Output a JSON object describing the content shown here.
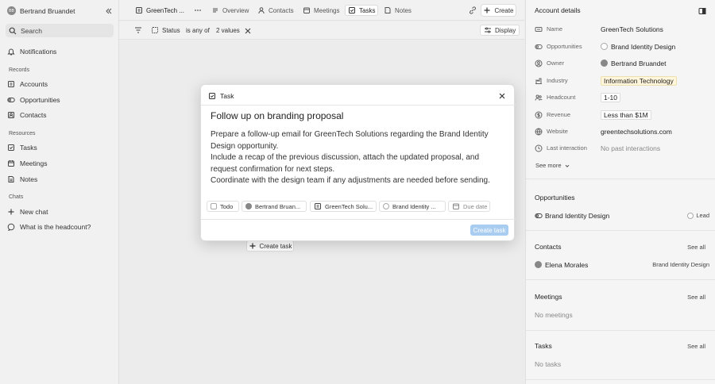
{
  "sidebar": {
    "workspace": {
      "initials": "BB",
      "name": "Bertrand Bruandet"
    },
    "search_label": "Search",
    "notifications": "Notifications",
    "records_heading": "Records",
    "records": [
      "Accounts",
      "Opportunities",
      "Contacts"
    ],
    "resources_heading": "Resources",
    "resources": [
      "Tasks",
      "Meetings",
      "Notes"
    ],
    "chats_heading": "Chats",
    "chats": [
      "New chat",
      "What is the headcount?"
    ]
  },
  "topbar": {
    "crumb": "GreenTech ...",
    "tabs": [
      "Overview",
      "Contacts",
      "Meetings",
      "Tasks",
      "Notes"
    ],
    "active_tab": "Tasks",
    "create_label": "Create"
  },
  "filters": {
    "field": "Status",
    "operator": "is any of",
    "value": "2 values",
    "display_label": "Display"
  },
  "main": {
    "create_task_label": "Create task"
  },
  "modal": {
    "header": "Task",
    "title": "Follow up on branding proposal",
    "body": [
      "Prepare a follow-up email for GreenTech Solutions regarding the Brand Identity Design opportunity.",
      "Include a recap of the previous discussion, attach the updated proposal, and request confirmation for next steps.",
      "Coordinate with the design team if any adjustments are needed before sending."
    ],
    "status": "Todo",
    "assignee": "Bertrand Bruan...",
    "account": "GreenTech Solu...",
    "opportunity": "Brand Identity ...",
    "due_date": "Due date",
    "create_label": "Create task"
  },
  "panel": {
    "title": "Account details",
    "fields": {
      "name": {
        "label": "Name",
        "value": "GreenTech Solutions"
      },
      "opportunities": {
        "label": "Opportunities",
        "value": "Brand Identity Design"
      },
      "owner": {
        "label": "Owner",
        "value": "Bertrand Bruandet"
      },
      "industry": {
        "label": "Industry",
        "value": "Information Technology"
      },
      "headcount": {
        "label": "Headcount",
        "value": "1-10"
      },
      "revenue": {
        "label": "Revenue",
        "value": "Less than $1M"
      },
      "website": {
        "label": "Website",
        "value": "greentechsolutions.com"
      },
      "last_interaction": {
        "label": "Last interaction",
        "value": "No past interactions"
      }
    },
    "see_more": "See more",
    "opportunities_section": {
      "heading": "Opportunities",
      "item": "Brand Identity Design",
      "stage": "Lead"
    },
    "contacts_section": {
      "heading": "Contacts",
      "see_all": "See all",
      "name": "Elena Morales",
      "related": "Brand Identity Design"
    },
    "meetings_section": {
      "heading": "Meetings",
      "see_all": "See all",
      "empty": "No meetings"
    },
    "tasks_section": {
      "heading": "Tasks",
      "see_all": "See all",
      "empty": "No tasks"
    }
  },
  "colors": {
    "accent": "#a9cdf1",
    "highlight": "#fff6dc"
  }
}
